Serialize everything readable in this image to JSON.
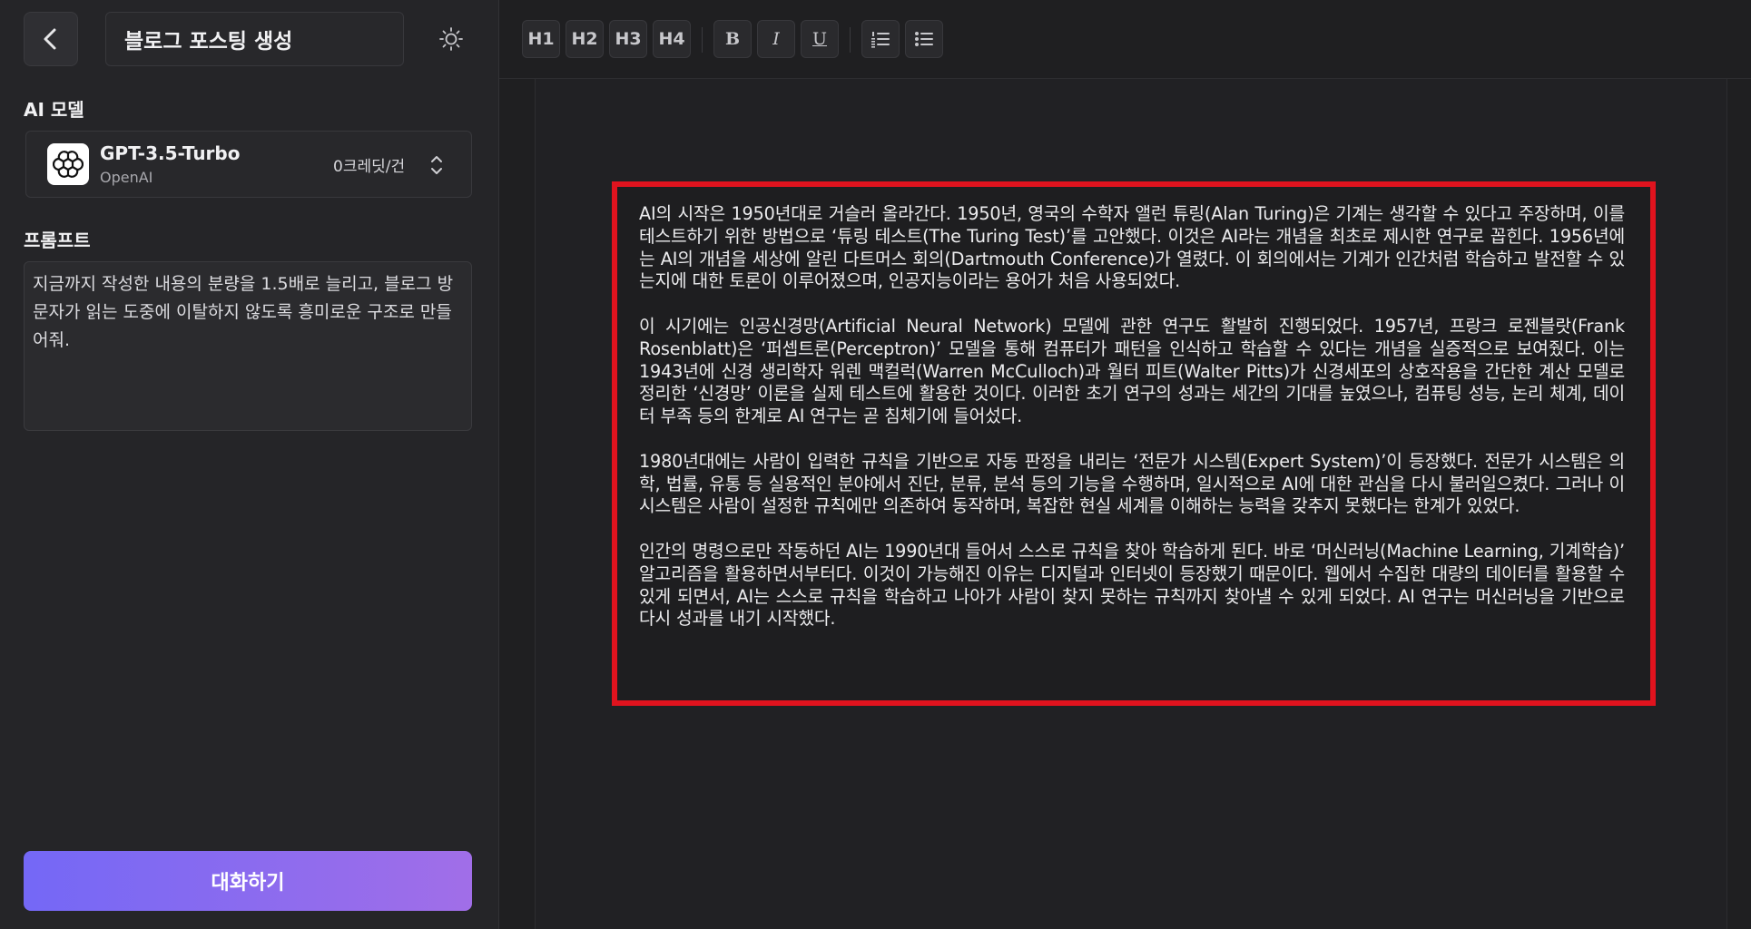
{
  "sidebar": {
    "title": "블로그 포스팅 생성",
    "model_section_label": "AI 모델",
    "model": {
      "name": "GPT-3.5-Turbo",
      "vendor": "OpenAI",
      "credit": "0크레딧/건"
    },
    "prompt_section_label": "프롬프트",
    "prompt_text": "지금까지 작성한 내용의 분량을 1.5배로 늘리고, 블로그 방문자가 읽는 도중에 이탈하지 않도록 흥미로운 구조로 만들어줘.",
    "submit_label": "대화하기"
  },
  "toolbar": {
    "headings": [
      "H1",
      "H2",
      "H3",
      "H4"
    ],
    "bold": "B",
    "italic": "I",
    "underline": "U"
  },
  "editor": {
    "paragraphs": [
      "AI의 시작은 1950년대로 거슬러 올라간다. 1950년, 영국의 수학자 앨런 튜링(Alan Turing)은 기계는 생각할 수 있다고 주장하며, 이를 테스트하기 위한 방법으로 ‘튜링 테스트(The Turing Test)’를 고안했다. 이것은 AI라는 개념을 최초로 제시한 연구로 꼽힌다. 1956년에는 AI의 개념을 세상에 알린 다트머스 회의(Dartmouth Conference)가 열렸다. 이 회의에서는 기계가 인간처럼 학습하고 발전할 수 있는지에 대한 토론이 이루어졌으며, 인공지능이라는 용어가 처음 사용되었다.",
      "이 시기에는 인공신경망(Artificial Neural Network) 모델에 관한 연구도 활발히 진행되었다. 1957년, 프랑크 로젠블랏(Frank Rosenblatt)은 ‘퍼셉트론(Perceptron)’ 모델을 통해 컴퓨터가 패턴을 인식하고 학습할 수 있다는 개념을 실증적으로 보여줬다. 이는 1943년에 신경 생리학자 워렌 맥컬럭(Warren McCulloch)과 월터 피트(Walter Pitts)가 신경세포의 상호작용을 간단한 계산 모델로 정리한 ‘신경망’ 이론을 실제 테스트에 활용한 것이다. 이러한 초기 연구의 성과는 세간의 기대를 높였으나, 컴퓨팅 성능, 논리 체계, 데이터 부족 등의 한계로 AI 연구는 곧 침체기에 들어섰다.",
      "1980년대에는 사람이 입력한 규칙을 기반으로 자동 판정을 내리는 ‘전문가 시스템(Expert System)’이 등장했다. 전문가 시스템은 의학, 법률, 유통 등 실용적인 분야에서 진단, 분류, 분석 등의 기능을 수행하며, 일시적으로 AI에 대한 관심을 다시 불러일으켰다. 그러나 이 시스템은 사람이 설정한 규칙에만 의존하여 동작하며, 복잡한 현실 세계를 이해하는 능력을 갖추지 못했다는 한계가 있었다.",
      "인간의 명령으로만 작동하던 AI는 1990년대 들어서 스스로 규칙을 찾아 학습하게 된다. 바로 ‘머신러닝(Machine Learning, 기계학습)’ 알고리즘을 활용하면서부터다. 이것이 가능해진 이유는 디지털과 인터넷이 등장했기 때문이다. 웹에서 수집한 대량의 데이터를 활용할 수 있게 되면서, AI는 스스로 규칙을 학습하고 나아가 사람이 찾지 못하는 규칙까지 찾아낼 수 있게 되었다. AI 연구는 머신러닝을 기반으로 다시 성과를 내기 시작했다."
    ]
  },
  "colors": {
    "accent_gradient_start": "#7468f6",
    "accent_gradient_end": "#a16ee8",
    "highlight_border": "#e0131e"
  }
}
